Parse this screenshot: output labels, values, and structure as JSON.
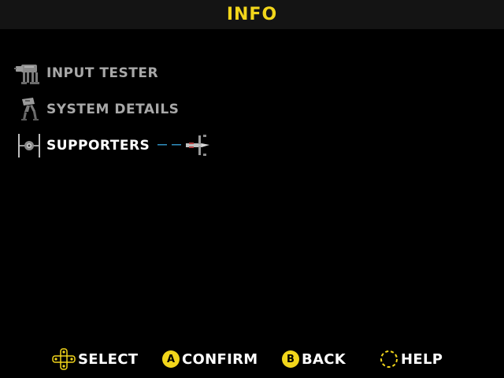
{
  "header": {
    "title": "INFO"
  },
  "menu": {
    "items": [
      {
        "label": "INPUT TESTER",
        "icon": "at-at-walker-icon",
        "selected": false
      },
      {
        "label": "SYSTEM DETAILS",
        "icon": "at-st-walker-icon",
        "selected": false
      },
      {
        "label": "SUPPORTERS",
        "icon": "tie-fighter-icon",
        "selected": true
      }
    ],
    "cursor_icon": "x-wing-icon"
  },
  "footer": {
    "hints": [
      {
        "label": "SELECT",
        "icon": "dpad-icon"
      },
      {
        "label": "CONFIRM",
        "button": "A"
      },
      {
        "label": "BACK",
        "button": "B"
      },
      {
        "label": "HELP",
        "icon": "dashed-circle-icon"
      }
    ]
  },
  "colors": {
    "accent": "#f2d61b",
    "header_bg": "#141414",
    "background": "#000000",
    "dim_text": "#a8a8a8",
    "selected_text": "#ffffff",
    "cursor_laser": "#2f8fbf"
  }
}
